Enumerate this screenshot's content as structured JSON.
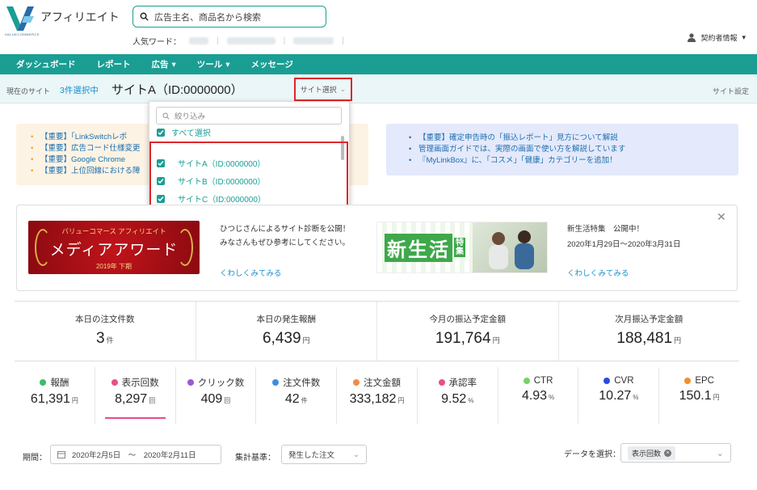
{
  "header": {
    "app_title": "アフィリエイト",
    "logo_text": "VALUECOMMERCE",
    "search_placeholder": "広告主名、商品名から検索",
    "popular_label": "人気ワード：",
    "account_label": "契約者情報"
  },
  "nav": {
    "items": [
      {
        "label": "ダッシュボード",
        "has_menu": false
      },
      {
        "label": "レポート",
        "has_menu": false
      },
      {
        "label": "広告",
        "has_menu": true
      },
      {
        "label": "ツール",
        "has_menu": true
      },
      {
        "label": "メッセージ",
        "has_menu": false
      }
    ]
  },
  "site_bar": {
    "current_label": "現在のサイト",
    "selected_count": "3件選択中",
    "current_site": "サイトA（ID:0000000）",
    "site_select_label": "サイト選択",
    "site_settings_label": "サイト設定"
  },
  "dropdown": {
    "filter_placeholder": "絞り込み",
    "select_all_label": "すべて選択",
    "sites": [
      {
        "label": "サイトA（ID:0000000）",
        "checked": true
      },
      {
        "label": "サイトB（ID:0000000）",
        "checked": true
      },
      {
        "label": "サイトC（ID:0000000）",
        "checked": true
      }
    ]
  },
  "notices_left": [
    "【重要】「LinkSwitchレポ",
    "【重要】広告コード仕様変更",
    "【重要】Google Chrome",
    "【重要】上位回線における障"
  ],
  "notices_right": [
    "【重要】確定申告時の「振込レポート」見方について解説",
    "管理画面ガイドでは、実際の画面で使い方を解説しています",
    "『MyLinkBox』に、「コスメ」「健康」カテゴリーを追加！"
  ],
  "banner1": {
    "award_top": "バリューコマース アフィリエイト",
    "award_main": "メディアアワード",
    "award_sub": "2019年 下期",
    "text_line1": "ひつじさんによるサイト診断を公開！",
    "text_line2": "みなさんもぜひ参考にしてください。",
    "link": "くわしくみてみる"
  },
  "banner2": {
    "image_text": "新生活",
    "image_text_small": "特集",
    "title": "新生活特集　公開中！",
    "date": "2020年1月29日〜2020年3月31日",
    "link": "くわしくみてみる"
  },
  "summary": [
    {
      "label": "本日の注文件数",
      "value": "3",
      "unit": "件"
    },
    {
      "label": "本日の発生報酬",
      "value": "6,439",
      "unit": "円"
    },
    {
      "label": "今月の振込予定金額",
      "value": "191,764",
      "unit": "円"
    },
    {
      "label": "次月振込予定金額",
      "value": "188,481",
      "unit": "円"
    }
  ],
  "metrics": [
    {
      "label": "報酬",
      "value": "61,391",
      "unit": "円",
      "color": "#3dbb6a",
      "active": false
    },
    {
      "label": "表示回数",
      "value": "8,297",
      "unit": "回",
      "color": "#e8508a",
      "active": true
    },
    {
      "label": "クリック数",
      "value": "409",
      "unit": "回",
      "color": "#9b59d0",
      "active": false
    },
    {
      "label": "注文件数",
      "value": "42",
      "unit": "件",
      "color": "#3a8fe0",
      "active": false
    },
    {
      "label": "注文金額",
      "value": "333,182",
      "unit": "円",
      "color": "#f08a4a",
      "active": false
    },
    {
      "label": "承認率",
      "value": "9.52",
      "unit": "%",
      "color": "#e8508a",
      "active": false
    },
    {
      "label": "CTR",
      "value": "4.93",
      "unit": "%",
      "color": "#7ad06a",
      "active": false
    },
    {
      "label": "CVR",
      "value": "10.27",
      "unit": "%",
      "color": "#2a4ae0",
      "active": false
    },
    {
      "label": "EPC",
      "value": "150.1",
      "unit": "円",
      "color": "#f0902a",
      "active": false
    }
  ],
  "controls": {
    "period_label": "期間：",
    "period_value": "2020年2月5日　〜　2020年2月11日",
    "basis_label": "集計基準：",
    "basis_value": "発生した注文",
    "data_label": "データを選択：",
    "data_chip": "表示回数"
  },
  "colors": {
    "brand": "#1a9e94",
    "highlight": "#e0262a",
    "link": "#1a8fd0"
  }
}
